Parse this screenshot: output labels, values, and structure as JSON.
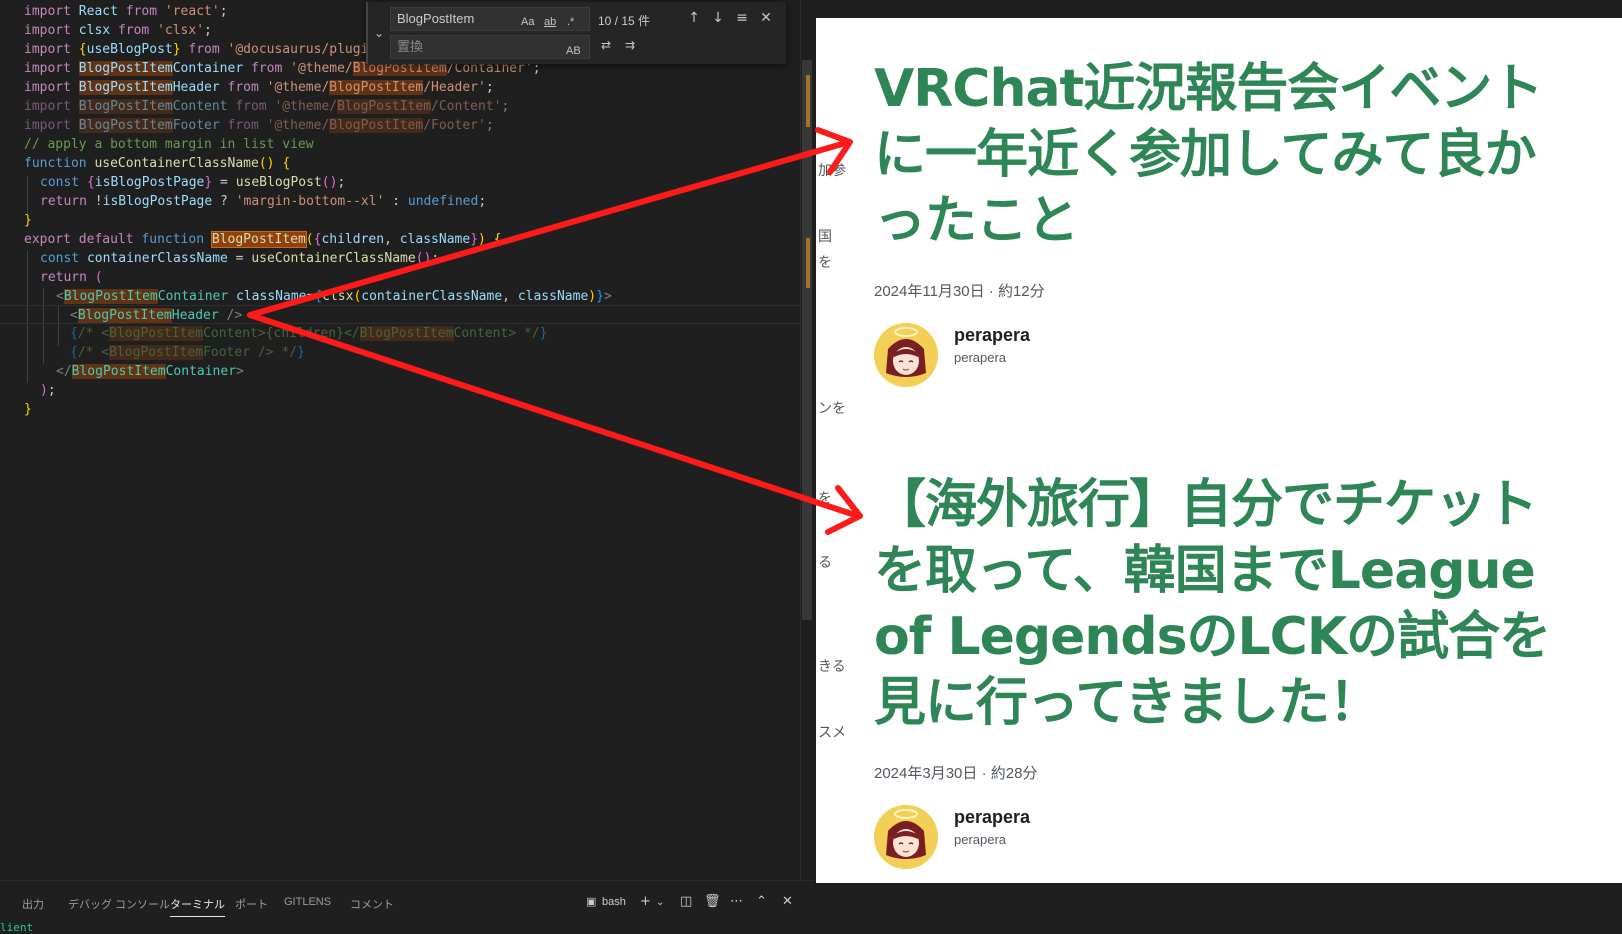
{
  "find_widget": {
    "search_value": "BlogPostItem",
    "replace_placeholder": "置換",
    "match_case": "Aa",
    "whole_word": "ab",
    "regex": ".*",
    "preserve_case": "AB",
    "result_count": "10 / 15 件"
  },
  "panel": {
    "tabs": [
      "出力",
      "デバッグ コンソール",
      "ターミナル",
      "ポート",
      "GITLENS",
      "コメント"
    ],
    "active_tab": "ターミナル",
    "shell": "bash",
    "terminal_line": "lient"
  },
  "side_fragments": [
    "加参",
    "国",
    "を",
    "ンを",
    "を",
    "る",
    "きる",
    "スメ"
  ],
  "blog": {
    "posts": [
      {
        "title": "VRChat近況報告会イベントに一年近く参加してみて良かったこと",
        "date": "2024年11月30日 · 約12分",
        "author_name": "perapera",
        "author_handle": "perapera"
      },
      {
        "title": "【海外旅行】自分でチケットを取って、韓国までLeague of LegendsのLCKの試合を見に行ってきました！",
        "date": "2024年3月30日 · 約28分",
        "author_name": "perapera",
        "author_handle": "perapera"
      }
    ]
  },
  "colors": {
    "accent_green": "#2e8555",
    "arrow_red": "#ff1a1a",
    "find_highlight": "#ea5c00"
  }
}
